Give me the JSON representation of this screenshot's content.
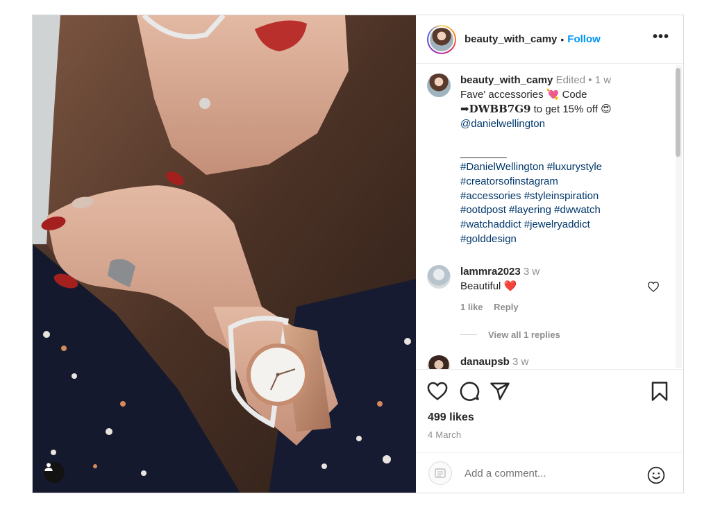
{
  "post": {
    "username": "beauty_with_camy",
    "follow_label": "Follow",
    "more_label": "•••",
    "header_dot": "•",
    "likes": "499 likes",
    "date": "4 March"
  },
  "caption": {
    "username": "beauty_with_camy",
    "edited": "Edited",
    "dot": "•",
    "time": "1 w",
    "line1": "Fave' accessories 💘 Code",
    "code": "➡DWBB7G9",
    "line2_rest": " to get 15% off 😍",
    "mention": "@danielwellington",
    "divider": "________",
    "hashtags": [
      "#DanielWellington #luxurystyle",
      "#creatorsofinstagram",
      "#accessories #styleinspiration",
      "#ootdpost #layering #dwwatch",
      "#watchaddict #jewelryaddict",
      "#golddesign"
    ]
  },
  "comments": [
    {
      "username": "lammra2023",
      "time": "3 w",
      "text": "Beautiful ❤️",
      "likes": "1 like",
      "reply_label": "Reply",
      "view_replies": "View all 1 replies"
    },
    {
      "username": "danaupsb",
      "time": "3 w"
    }
  ],
  "composer": {
    "placeholder": "Add a comment..."
  },
  "icons": {
    "like": "heart-icon",
    "comment": "comment-icon",
    "share": "paper-plane-icon",
    "save": "bookmark-icon",
    "emoji": "smiley-icon",
    "tag": "user-tag-icon"
  },
  "colors": {
    "follow": "#0095f6",
    "hashtag": "#00376b",
    "muted": "#8e8e8e"
  }
}
